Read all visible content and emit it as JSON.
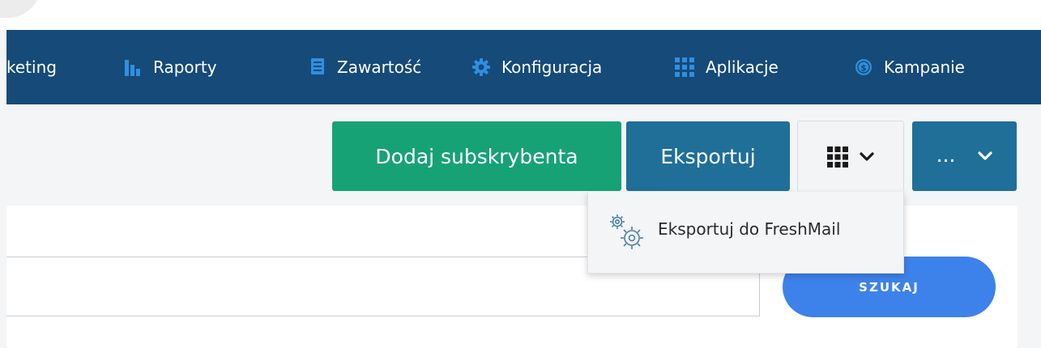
{
  "navbar": {
    "items": [
      {
        "label": "keting",
        "icon": "none"
      },
      {
        "label": "Raporty",
        "icon": "bar-chart-icon"
      },
      {
        "label": "Zawartość",
        "icon": "document-icon"
      },
      {
        "label": "Konfiguracja",
        "icon": "gear-icon"
      },
      {
        "label": "Aplikacje",
        "icon": "grid-icon"
      },
      {
        "label": "Kampanie",
        "icon": "dollar-circle-icon"
      }
    ],
    "colors": {
      "background": "#164a78",
      "icon": "#2f8fe0",
      "text": "#ffffff"
    }
  },
  "toolbar": {
    "add_label": "Dodaj subskrybenta",
    "export_label": "Eksportuj",
    "grid_icon": "grid-icon",
    "more_label": "...",
    "colors": {
      "add": "#17a275",
      "export": "#1f6f99",
      "more": "#1f6f99"
    }
  },
  "dropdown": {
    "items": [
      {
        "label": "Eksportuj do FreshMail",
        "icon": "gears-icon"
      }
    ]
  },
  "search": {
    "value": "",
    "button_label": "SZUKAJ",
    "button_color": "#3d82ea"
  }
}
